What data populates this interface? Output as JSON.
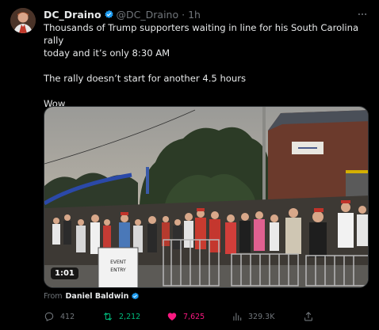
{
  "author": {
    "display_name": "DC_Draino",
    "handle": "@DC_Draino",
    "separator": "·",
    "time": "1h"
  },
  "tweet": {
    "line1": "Thousands of Trump supporters waiting in line for his South Carolina rally",
    "line2": "today and it’s only 8:30 AM",
    "line3": "The rally doesn’t start for another 4.5 hours",
    "line4": "Wow"
  },
  "media": {
    "duration": "1:01",
    "sign_text": "EVENT ENTRY"
  },
  "source": {
    "label": "From",
    "name": "Daniel Baldwin"
  },
  "actions": {
    "replies": "412",
    "retweets": "2,212",
    "likes": "7,625",
    "views": "329.3K"
  },
  "colors": {
    "background": "#000000",
    "text": "#e7e9ea",
    "muted": "#71767b",
    "verified": "#1d9bf0",
    "retweet_active": "#00ba7c",
    "like_active": "#f91880"
  },
  "icons": [
    "more-icon",
    "verified-badge-icon",
    "reply-icon",
    "retweet-icon",
    "like-icon",
    "views-icon",
    "share-icon"
  ]
}
